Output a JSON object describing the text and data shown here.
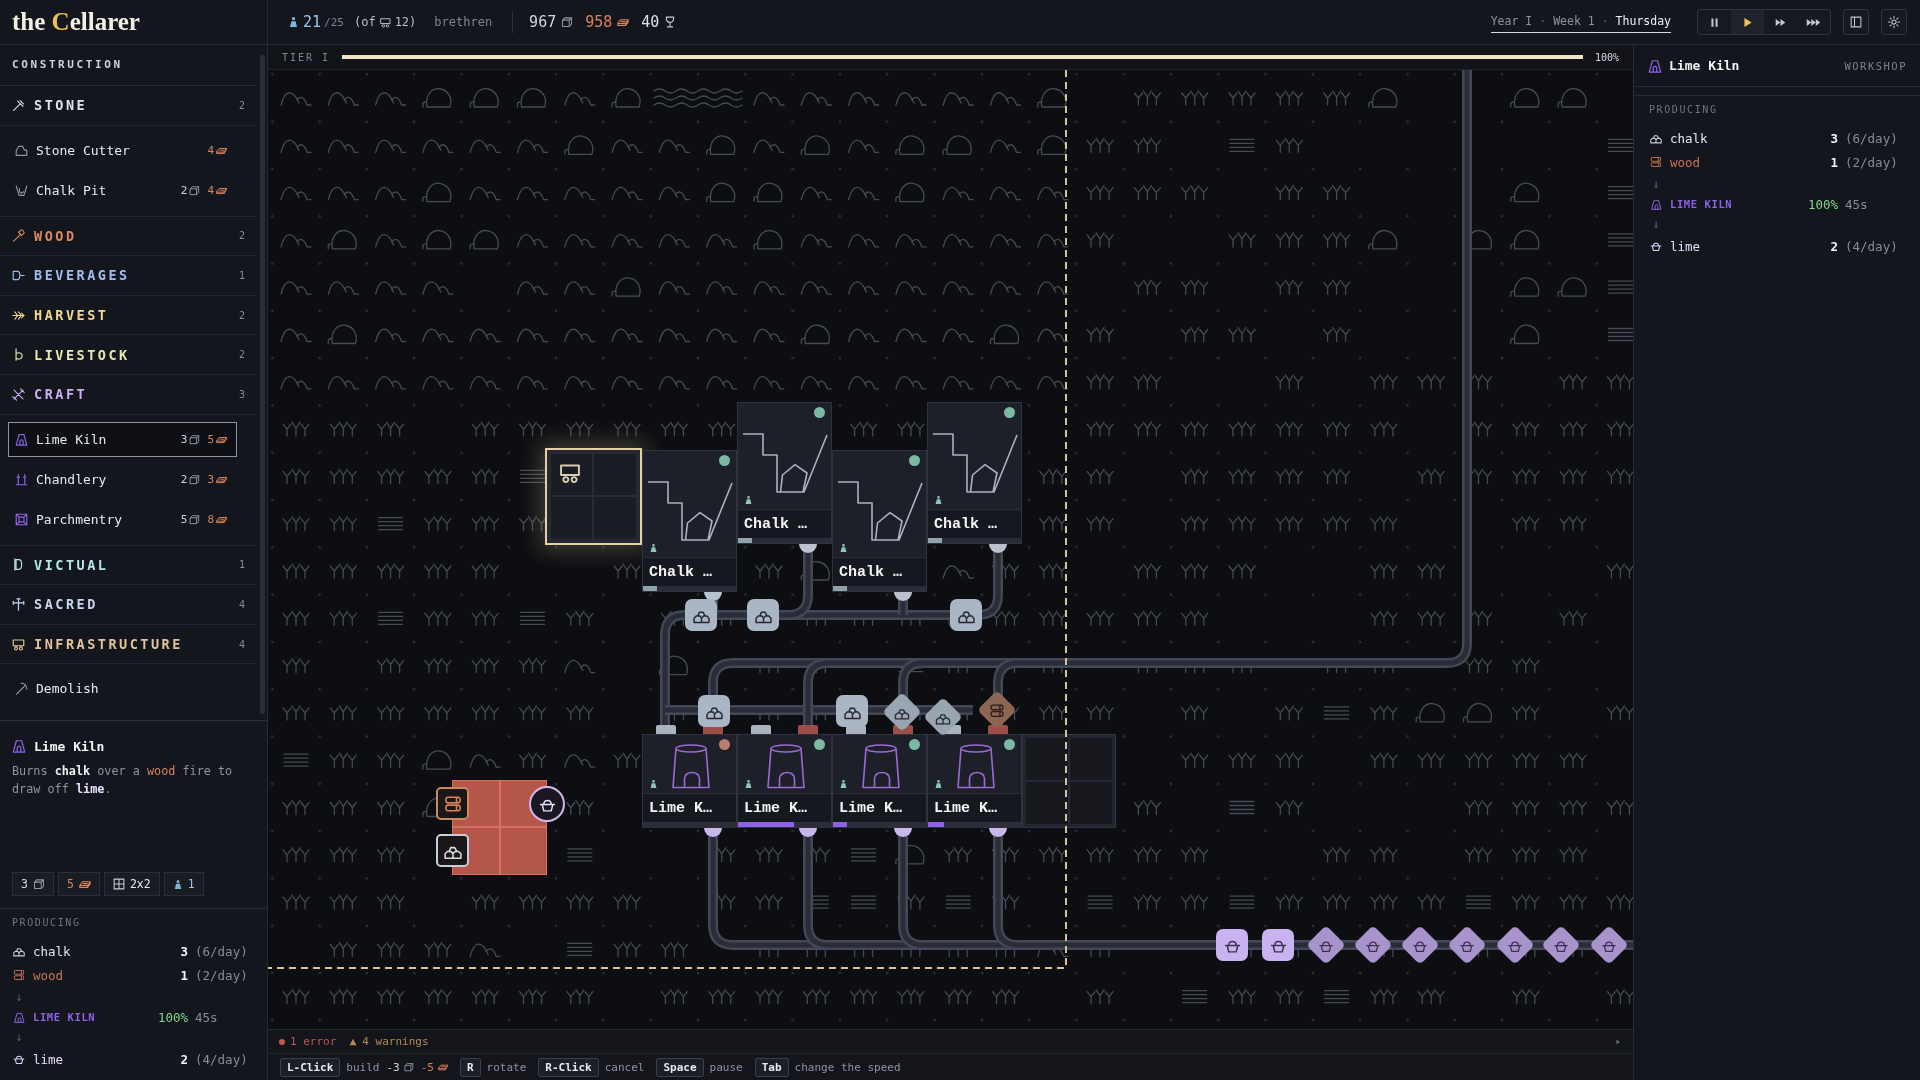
{
  "app": {
    "title": "the Cellarer"
  },
  "top_bar": {
    "population": {
      "count": "21",
      "capacity": "/25",
      "housing_text": "(of",
      "housing_count": "12)",
      "label": "brethren"
    },
    "resources": [
      {
        "kind": "stone",
        "amount": "967"
      },
      {
        "kind": "wood",
        "amount": "958"
      },
      {
        "kind": "faith",
        "amount": "40"
      }
    ],
    "calendar": [
      {
        "kind": "year",
        "text": "Year I"
      },
      {
        "kind": "separator",
        "text": "·"
      },
      {
        "kind": "week",
        "text": "Week 1"
      },
      {
        "kind": "separator",
        "text": "·"
      },
      {
        "kind": "day",
        "text": "Thursday"
      }
    ],
    "speed": [
      {
        "kind": "pause",
        "selected": false
      },
      {
        "kind": "play",
        "selected": true
      },
      {
        "kind": "fast",
        "selected": false
      },
      {
        "kind": "fastest",
        "selected": false
      }
    ],
    "tools": [
      {
        "kind": "panel"
      },
      {
        "kind": "settings"
      }
    ]
  },
  "sidebar": {
    "heading": "CONSTRUCTION",
    "categories": [
      {
        "kind": "stone",
        "name": "STONE",
        "count": "2",
        "color": "#dde4ef",
        "items": [
          {
            "kind": "stone_cutter",
            "name": "Stone Cutter",
            "selected": false,
            "costs": [
              {
                "kind": "wood",
                "amount": "4"
              }
            ]
          },
          {
            "kind": "chalk_pit",
            "name": "Chalk Pit",
            "selected": false,
            "costs": [
              {
                "kind": "stone",
                "amount": "2"
              },
              {
                "kind": "wood",
                "amount": "4"
              }
            ]
          }
        ]
      },
      {
        "kind": "wood",
        "name": "WOOD",
        "count": "2",
        "color": "#dc8a5e"
      },
      {
        "kind": "beverages",
        "name": "BEVERAGES",
        "count": "1",
        "color": "#a3bcf2"
      },
      {
        "kind": "harvest",
        "name": "HARVEST",
        "count": "2",
        "color": "#f0d890"
      },
      {
        "kind": "livestock",
        "name": "LIVESTOCK",
        "count": "2",
        "color": "#e6eaae"
      },
      {
        "kind": "craft",
        "name": "CRAFT",
        "count": "3",
        "color": "#cbaef2",
        "items": [
          {
            "kind": "lime_kiln",
            "name": "Lime Kiln",
            "selected": true,
            "costs": [
              {
                "kind": "stone",
                "amount": "3"
              },
              {
                "kind": "wood",
                "amount": "5"
              }
            ]
          },
          {
            "kind": "chandlery",
            "name": "Chandlery",
            "selected": false,
            "costs": [
              {
                "kind": "stone",
                "amount": "2"
              },
              {
                "kind": "wood",
                "amount": "3"
              }
            ]
          },
          {
            "kind": "parchmentry",
            "name": "Parchmentry",
            "selected": false,
            "costs": [
              {
                "kind": "stone",
                "amount": "5"
              },
              {
                "kind": "wood",
                "amount": "8"
              }
            ]
          }
        ]
      },
      {
        "kind": "victual",
        "name": "VICTUAL",
        "count": "1",
        "color": "#b2e8e8"
      },
      {
        "kind": "sacred",
        "name": "SACRED",
        "count": "4",
        "color": "#c6d8f0"
      },
      {
        "kind": "infrastructure",
        "name": "INFRASTRUCTURE",
        "count": "4",
        "color": "#e2c49a"
      }
    ],
    "tools": [
      {
        "kind": "demolish",
        "name": "Demolish",
        "selected": false
      }
    ],
    "detail": {
      "kind": "lime_kiln",
      "title": "Lime Kiln",
      "description": [
        {
          "kind": "plain",
          "text": "Burns "
        },
        {
          "kind": "chalk",
          "text": "chalk"
        },
        {
          "kind": "plain",
          "text": " over a "
        },
        {
          "kind": "wood",
          "text": "wood"
        },
        {
          "kind": "plain",
          "text": " fire to draw off "
        },
        {
          "kind": "lime",
          "text": "lime"
        },
        {
          "kind": "plain",
          "text": "."
        }
      ],
      "chips": [
        {
          "kind": "stone",
          "value": "3"
        },
        {
          "kind": "wood",
          "value": "5"
        },
        {
          "kind": "size",
          "value": "2x2"
        },
        {
          "kind": "workers",
          "value": "1"
        }
      ],
      "producing": {
        "heading": "PRODUCING",
        "rows": [
          {
            "kind": "chalk",
            "name": "chalk",
            "amount": "3",
            "rate": "(6/day)"
          },
          {
            "kind": "wood",
            "name": "wood",
            "amount": "1",
            "rate": "(2/day)"
          },
          {
            "kind": "arrow",
            "text": "↓"
          },
          {
            "kind": "lime_kiln",
            "name": "LIME KILN",
            "efficiency": "100%",
            "duration": "45s"
          },
          {
            "kind": "arrow",
            "text": "↓"
          },
          {
            "kind": "lime",
            "name": "lime",
            "amount": "2",
            "rate": "(4/day)"
          }
        ]
      }
    }
  },
  "tier": {
    "label": "TIER I",
    "level": 1,
    "reading": "100%"
  },
  "canvas": {
    "buildings": [
      {
        "kind": "cart_depot",
        "highlighted": true
      },
      {
        "kind": "chalk_pit",
        "label": "Chalk …",
        "color": "#7bb9a3",
        "level": 0.15
      },
      {
        "kind": "chalk_pit",
        "label": "Chalk …",
        "color": "#7bb9a3",
        "level": 0.15
      },
      {
        "kind": "chalk_pit",
        "label": "Chalk …",
        "color": "#7bb9a3",
        "level": 0.15
      },
      {
        "kind": "chalk_pit",
        "label": "Chalk …",
        "color": "#7bb9a3",
        "level": 0.15
      },
      {
        "kind": "lime_kiln",
        "label": "Lime K…",
        "color": "#b8806c",
        "level": 0
      },
      {
        "kind": "lime_kiln",
        "label": "Lime K…",
        "color": "#7bb9a3",
        "level": 0.6
      },
      {
        "kind": "lime_kiln",
        "label": "Lime K…",
        "color": "#7bb9a3",
        "level": 0.15
      },
      {
        "kind": "lime_kiln",
        "label": "Lime K…",
        "color": "#7bb9a3",
        "level": 0.17
      },
      {
        "kind": "empty_plot"
      }
    ],
    "build_preview": {
      "valid": false
    },
    "items": [
      {
        "kind": "chalk"
      },
      {
        "kind": "chalk"
      },
      {
        "kind": "chalk"
      },
      {
        "kind": "chalk"
      },
      {
        "kind": "chalk"
      },
      {
        "kind": "chalk"
      },
      {
        "kind": "chalk"
      },
      {
        "kind": "wood"
      },
      {
        "kind": "lime"
      },
      {
        "kind": "lime"
      },
      {
        "kind": "lime"
      },
      {
        "kind": "lime"
      },
      {
        "kind": "lime"
      },
      {
        "kind": "lime"
      },
      {
        "kind": "lime"
      },
      {
        "kind": "lime"
      },
      {
        "kind": "lime"
      }
    ]
  },
  "status_bar": {
    "errors": "1 error",
    "warnings": "4 warnings",
    "hints": [
      {
        "key": "L-Click",
        "action": "build",
        "costs": [
          {
            "kind": "stone",
            "amount": "-3"
          },
          {
            "kind": "wood",
            "amount": "-5"
          }
        ]
      },
      {
        "key": "R",
        "action": "rotate"
      },
      {
        "key": "R-Click",
        "action": "cancel"
      },
      {
        "key": "Space",
        "action": "pause"
      },
      {
        "key": "Tab",
        "action": "change the speed"
      }
    ]
  },
  "inspector": {
    "kind": "lime_kiln",
    "title": "Lime Kiln",
    "type": "WORKSHOP",
    "producing": {
      "heading": "PRODUCING",
      "rows": [
        {
          "kind": "chalk",
          "name": "chalk",
          "amount": "3",
          "rate": "(6/day)"
        },
        {
          "kind": "wood",
          "name": "wood",
          "amount": "1",
          "rate": "(2/day)"
        },
        {
          "kind": "arrow",
          "text": "↓"
        },
        {
          "kind": "lime_kiln",
          "name": "LIME KILN",
          "efficiency": "100%",
          "duration": "45s"
        },
        {
          "kind": "arrow",
          "text": "↓"
        },
        {
          "kind": "lime",
          "name": "lime",
          "amount": "2",
          "rate": "(4/day)"
        }
      ]
    }
  }
}
